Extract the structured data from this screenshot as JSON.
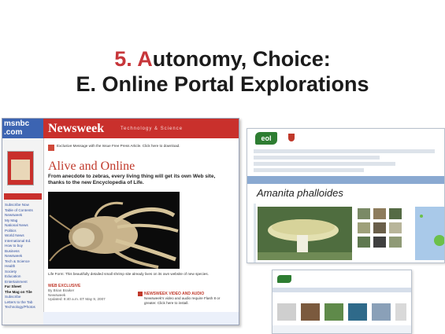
{
  "slide": {
    "title_num": "5. ",
    "title_first_letter": "A",
    "title_line1_rest": "utonomy, Choice:",
    "title_line2": "E. Online Portal Explorations"
  },
  "colors": {
    "accent": "#c7363a",
    "newsweek_red": "#c9302c",
    "msnbc_blue": "#3c64b2",
    "eol_green": "#2e7d32"
  },
  "left_screenshot": {
    "msnbc_logo_line1": "msnbc",
    "msnbc_logo_line2": ".com",
    "newsweek_logo": "Newsweek",
    "newsweek_section": "Technology & Science",
    "notice": "Exclusive Message with the Issue Free Press Article. Click here to download.",
    "headline": "Alive and Online",
    "deck": "From anecdote to zebras, every living thing will get its own Web site, thanks to the new Encyclopedia of Life.",
    "caption": "Life Form: This beautifully detailed small shrimp site already lives on its own website of new species.",
    "web_exclusive_heading": "WEB EXCLUSIVE",
    "byline_author": "By Brian Braiker",
    "byline_org": "Newsweek",
    "byline_date": "Updated: 8:40 a.m. ET May 9, 2007",
    "extra_heading": "NEWSWEEK VIDEO AND AUDIO",
    "extra_text": "Newsweek's video and audio require Flash 8 or greater. Click here to install.",
    "nav_items": [
      "Subscribe Now",
      "Table of Contents",
      "Newsweek",
      "My Mag",
      "National News",
      "Politics",
      "World News",
      "International Ed.",
      "How to buy",
      "Business",
      "Newsweek",
      "Tech & Science",
      "Health",
      "Society",
      "Education",
      "Entertainment",
      "Far Sheet",
      "The Mag on Tile",
      "Subscribe",
      "Letters to the Tab",
      "Technology/Photos"
    ]
  },
  "right_top_screenshot": {
    "logo": "eol",
    "species_title": "Amanita phalloides"
  },
  "right_bottom_screenshot": {
    "logo": "eol"
  }
}
